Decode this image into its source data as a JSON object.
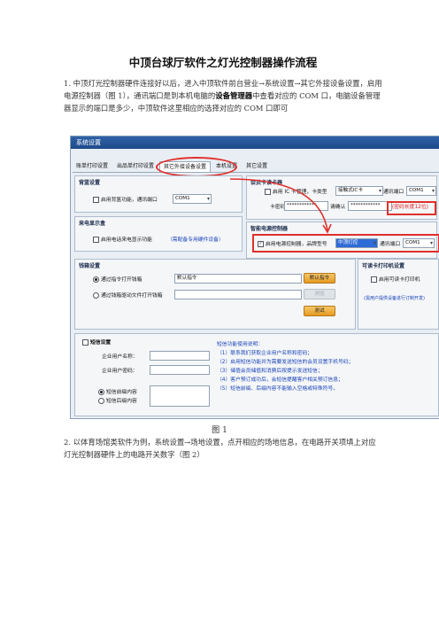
{
  "document": {
    "title": "中顶台球厅软件之灯光控制器操作流程",
    "step1_prefix": "1. 中顶灯光控制器硬件连接好以后，进入中顶软件前台营业→系统设置→其它外接设备设置，启用电源控制器（图 1），通讯端口是到本机电脑的",
    "step1_bold": "设备管理器",
    "step1_suffix": "中查看对应的 COM 口，电脑设备管理器显示的端口是多少，中顶软件这里相应的选择对应的 COM 口即可",
    "figure_caption": "图 1",
    "step2": "2. 以体育场馆类软件为例，系统设置→场地设置，点开相应的场地信息，在电路开关项填上对应灯光控制器硬件上的电路开关数字（图 2）"
  },
  "screenshot": {
    "window_title": "系统设置",
    "tabs": [
      "账单打印设置",
      "出品单打印设置",
      "其它外接设备设置",
      "本机设置",
      "其它设置"
    ],
    "active_tab": "其它外接设备设置",
    "scale_panel": {
      "title": "背篮设置",
      "checkbox_label": "启用背篮功能，通讯端口",
      "port_value": "COM1"
    },
    "member_card_panel": {
      "title": "会员卡读卡器",
      "enable_label": "启用 IC 卡管理，卡类型",
      "card_type": "接触式IC卡",
      "port_label": "通讯端口",
      "port_value": "COM1",
      "password_label": "卡密码",
      "password_value": "************",
      "confirm_label": "请确认",
      "confirm_value": "************",
      "password_note": "(密码长度12位)"
    },
    "caller_panel": {
      "title": "来电显示盒",
      "checkbox_label": "启用电话来电显示功能",
      "note": "（需配备专用硬件设备）"
    },
    "smart_power_panel": {
      "title": "智能电源控制器",
      "enable_label": "启用电源控制器，品牌型号",
      "enabled": true,
      "brand_value": "中顶灯控",
      "port_label": "通讯端口",
      "port_value": "COM1"
    },
    "cashbox_panel": {
      "title": "钱箱设置",
      "option1": "通过指令打开钱箱",
      "option1_value": "默认指令",
      "option1_button": "默认指令",
      "option2": "通过钱箱驱动文件打开钱箱",
      "option2_button": "浏览",
      "test_button": "测试"
    },
    "card_printer_panel": {
      "title": "可读卡打印机设置",
      "checkbox_label": "启用可读卡打印机",
      "note": "(需用户提供设备进行订制开发)"
    },
    "sms_panel": {
      "title": "短信设置",
      "company_name_label": "企业用户名称：",
      "company_password_label": "企业用户密码：",
      "radio1": "短信前缀内容",
      "radio2": "短信后缀内容",
      "help_title": "短信功能使用说明：",
      "help_lines": [
        "（1）联系我们获取企业用户名称和密码；",
        "（2）启用短信功能并为需要发送短信的会员设置手机号码；",
        "（3）储值会员储值和消费后按提示发送短信；",
        "（4）客户预订成功后，会短信提醒客户相关预订信息；",
        "（5）短信前缀、后缀内容不能输入空格或特殊符号。"
      ]
    }
  }
}
